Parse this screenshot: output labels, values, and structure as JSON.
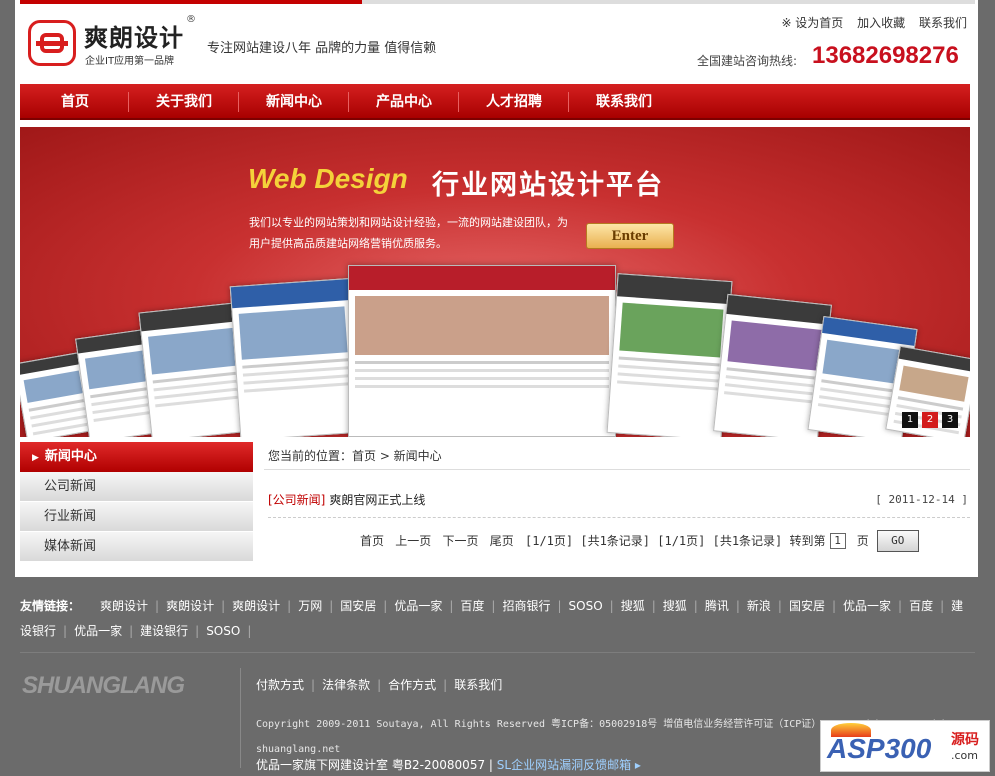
{
  "header": {
    "logo_name": "爽朗设计",
    "logo_reg": "®",
    "logo_sub": "企业IT应用第一品牌",
    "slogan": "专注网站建设八年 品牌的力量 值得信赖",
    "top_links": [
      "※ 设为首页",
      "加入收藏",
      "联系我们"
    ],
    "hotline_label": "全国建站咨询热线:",
    "hotline": "13682698276"
  },
  "nav": {
    "items": [
      "首页",
      "关于我们",
      "新闻中心",
      "产品中心",
      "人才招聘",
      "联系我们"
    ]
  },
  "banner": {
    "title_en": "Web Design",
    "title_cn": "行业网站设计平台",
    "text": "我们以专业的网站策划和网站设计经验，一流的网站建设团队，为用户提供高品质建站网络营销优质服务。",
    "enter_label": "Enter",
    "slides": [
      "1",
      "2",
      "3"
    ],
    "active_slide": 2
  },
  "sidebar": {
    "heading": "新闻中心",
    "items": [
      "公司新闻",
      "行业新闻",
      "媒体新闻"
    ]
  },
  "main": {
    "breadcrumb": "您当前的位置：首页 > 新闻中心",
    "news": [
      {
        "category": "[公司新闻]",
        "title": "爽朗官网正式上线",
        "date": "[ 2011-12-14 ]"
      }
    ],
    "pager": {
      "first": "首页",
      "prev": "上一页",
      "next": "下一页",
      "last": "尾页",
      "info": "[1/1页] [共1条记录] [1/1页] [共1条记录] 转到第",
      "page_value": "1",
      "page_suffix": "页",
      "go_label": "GO"
    }
  },
  "footer": {
    "friends_label": "友情链接：",
    "friends": [
      "爽朗设计",
      "爽朗设计",
      "爽朗设计",
      "万网",
      "国安居",
      "优品一家",
      "百度",
      "招商银行",
      "SOSO",
      "搜狐",
      "搜狐",
      "腾讯",
      "新浪",
      "国安居",
      "优品一家",
      "百度",
      "建设银行",
      "优品一家",
      "建设银行",
      "SOSO"
    ],
    "logo_text": "SHUANGLANG",
    "links": [
      "付款方式",
      "法律条款",
      "合作方式",
      "联系我们"
    ],
    "copyright": "Copyright 2009-2011 Soutaya, All Rights Reserved 粤ICP备：05002918号 增值电信业务经营许可证（ICP证） powered by powered by shuanglang.net",
    "bottom_text": "优品一家旗下网建设计室 粤B2-20080057",
    "bottom_link": "SL企业网站漏洞反馈邮箱 ▸"
  },
  "watermark": {
    "asp": "ASP300",
    "yuan": "源码",
    "com": ".com"
  },
  "colors": {
    "brand_red": "#c40000",
    "hotline_red": "#c8101e",
    "footer_bg": "#6b6b6b",
    "banner_title_gold": "#f4d23a"
  }
}
